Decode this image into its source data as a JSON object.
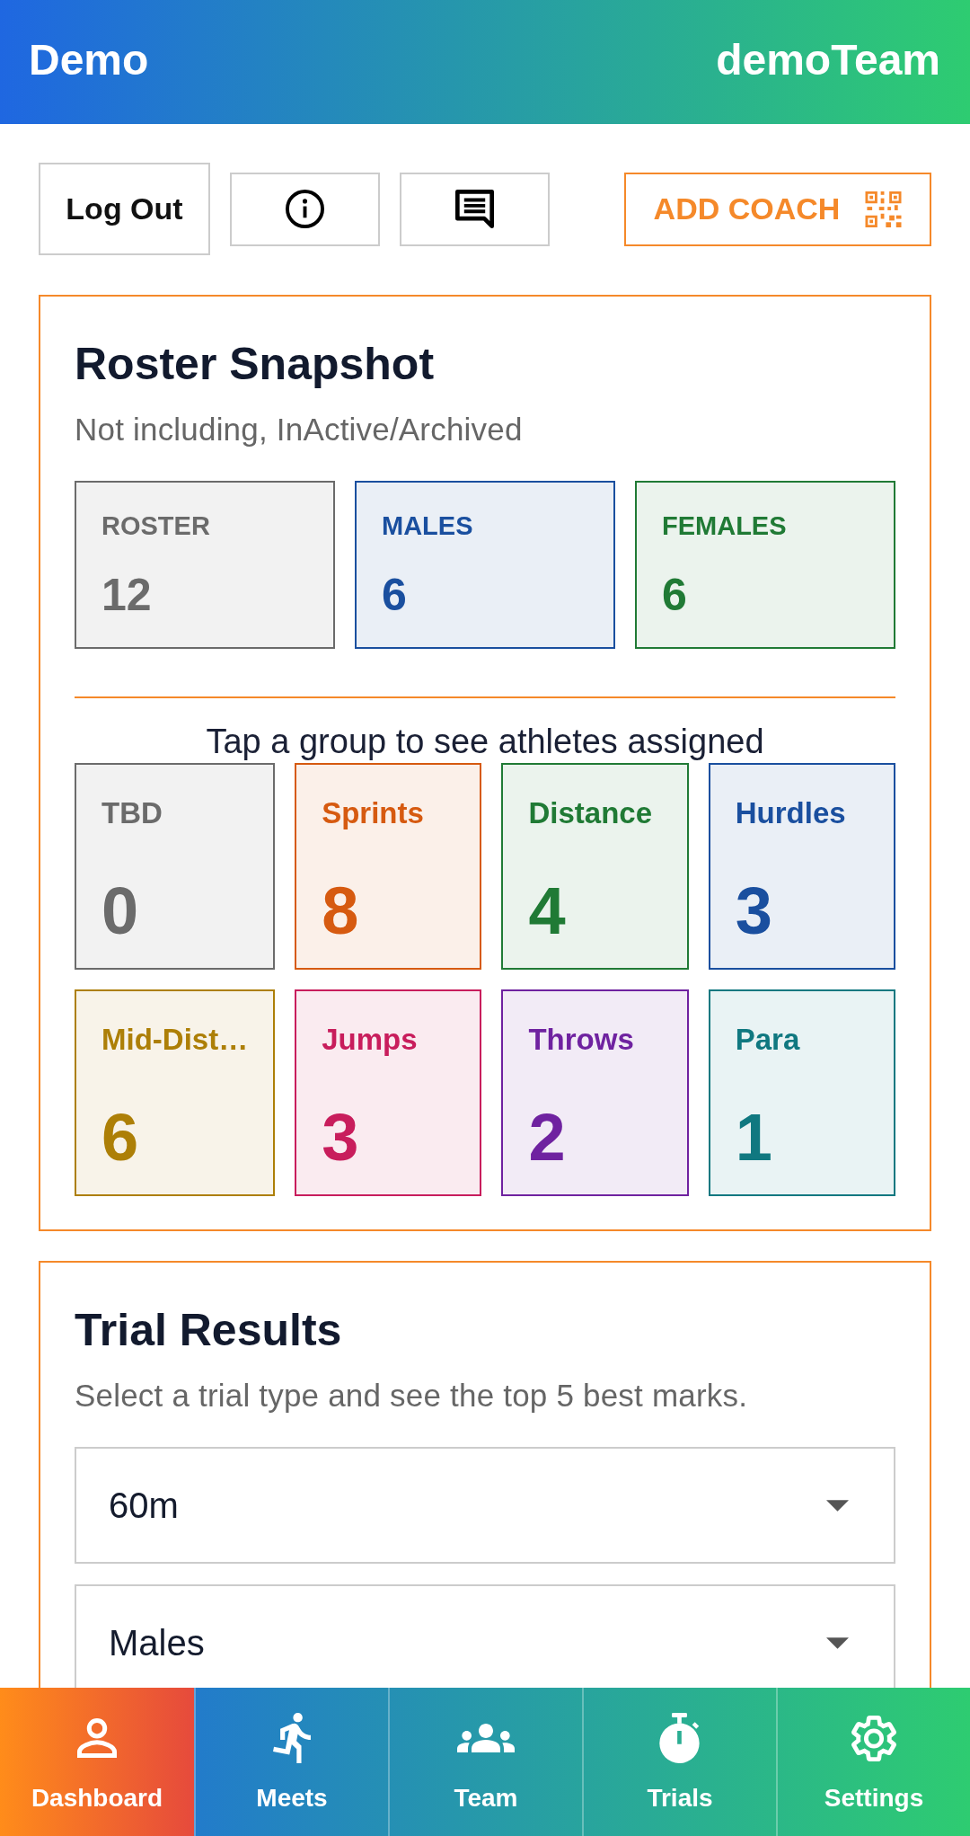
{
  "header": {
    "title": "Demo",
    "team": "demoTeam"
  },
  "toolbar": {
    "logout": {
      "label": "Log Out"
    },
    "add_coach": {
      "label": "ADD COACH"
    }
  },
  "roster_snapshot": {
    "title": "Roster Snapshot",
    "subtitle": "Not including, InActive/Archived",
    "stats": [
      {
        "label": "ROSTER",
        "value": "12",
        "color": "#6b6b6b"
      },
      {
        "label": "MALES",
        "value": "6",
        "color": "#1a4f9f"
      },
      {
        "label": "FEMALES",
        "value": "6",
        "color": "#207a35"
      }
    ],
    "hint": "Tap a group to see athletes assigned",
    "groups": [
      {
        "label": "TBD",
        "count": "0",
        "color": "#6b6b6b"
      },
      {
        "label": "Sprints",
        "count": "8",
        "color": "#d65a10"
      },
      {
        "label": "Distance",
        "count": "4",
        "color": "#207a35"
      },
      {
        "label": "Hurdles",
        "count": "3",
        "color": "#1a4f9f"
      },
      {
        "label": "Mid-Dist…",
        "count": "6",
        "color": "#ad7f07"
      },
      {
        "label": "Jumps",
        "count": "3",
        "color": "#c81d5c"
      },
      {
        "label": "Throws",
        "count": "2",
        "color": "#6f22a0"
      },
      {
        "label": "Para",
        "count": "1",
        "color": "#107880"
      }
    ]
  },
  "trial_results": {
    "title": "Trial Results",
    "subtitle": "Select a trial type and see the top 5 best marks.",
    "selects": [
      {
        "value": "60m"
      },
      {
        "value": "Males"
      }
    ]
  },
  "nav": [
    {
      "label": "Dashboard",
      "selected": true
    },
    {
      "label": "Meets",
      "selected": false
    },
    {
      "label": "Team",
      "selected": false
    },
    {
      "label": "Trials",
      "selected": false
    },
    {
      "label": "Settings",
      "selected": false
    }
  ]
}
